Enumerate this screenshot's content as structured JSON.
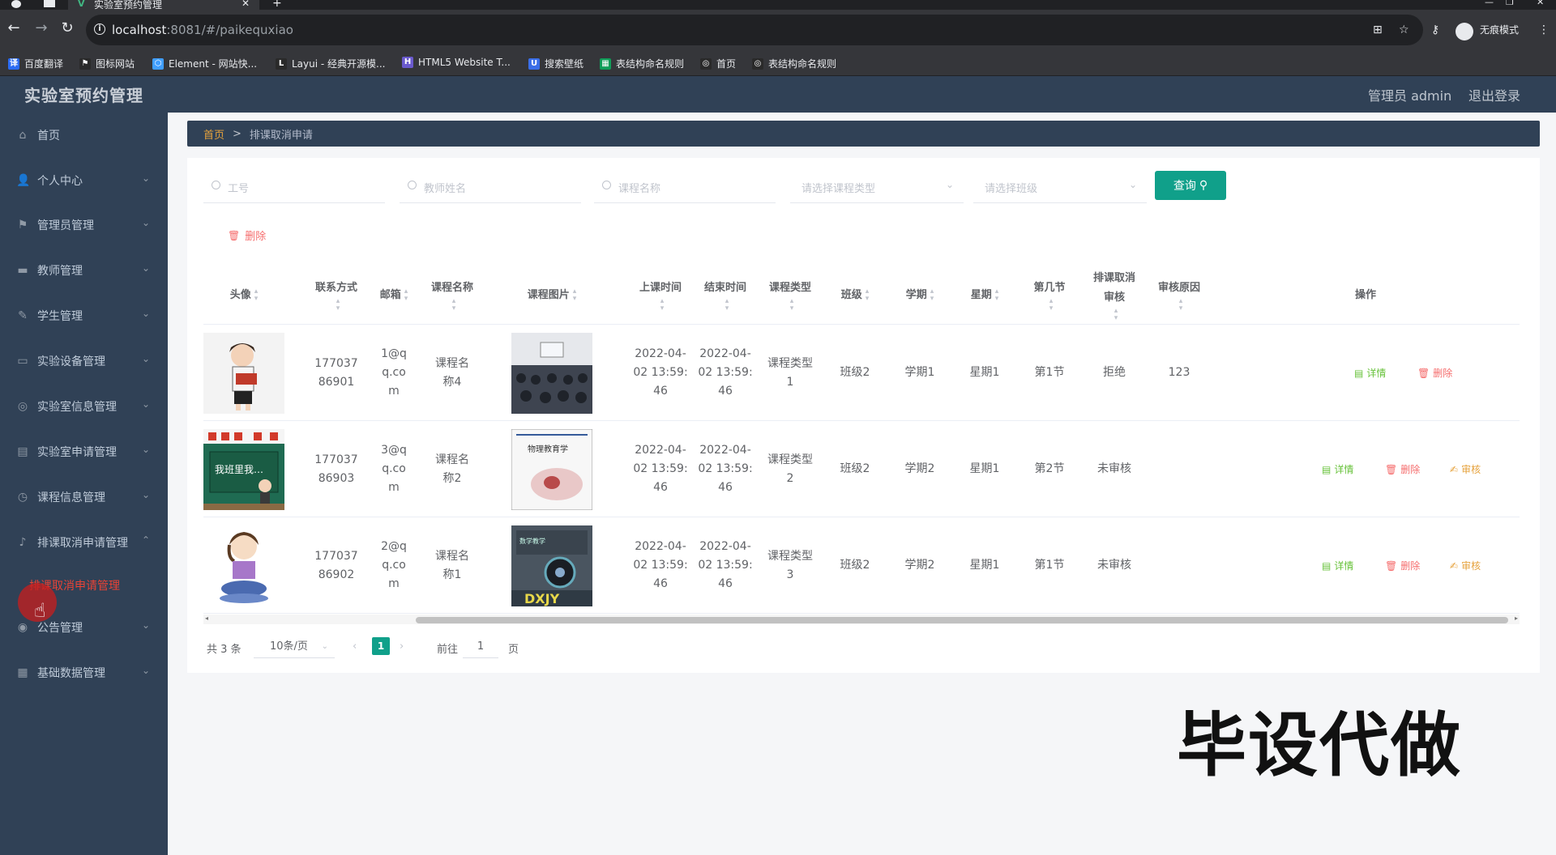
{
  "browser": {
    "tab_title": "实验室预约管理",
    "url_host": "localhost",
    "url_rest": ":8081/#/paikequxiao",
    "incognito_label": "无痕模式",
    "bookmarks": [
      {
        "label": "百度翻译",
        "color": "#2b6cf5",
        "icon": "译"
      },
      {
        "label": "图标网站",
        "color": "#2a2a2a",
        "icon": "⚑"
      },
      {
        "label": "Element - 网站快...",
        "color": "#409eff",
        "icon": "⬡"
      },
      {
        "label": "Layui - 经典开源模...",
        "color": "#2a2a2a",
        "icon": "L"
      },
      {
        "label": "HTML5 Website T...",
        "color": "#6a5acd",
        "icon": "H"
      },
      {
        "label": "搜索壁纸",
        "color": "#3a6ee8",
        "icon": "U"
      },
      {
        "label": "表结构命名规则",
        "color": "#0f9d58",
        "icon": "▦"
      },
      {
        "label": "首页",
        "color": "#2a2a2a",
        "icon": "◎"
      },
      {
        "label": "表结构命名规则",
        "color": "#2a2a2a",
        "icon": "◎"
      }
    ]
  },
  "header": {
    "title": "实验室预约管理",
    "user": "管理员 admin",
    "logout": "退出登录"
  },
  "sidebar": {
    "items": [
      {
        "label": "首页",
        "icon": "home-icon",
        "glyph": "⌂",
        "has_arrow": false
      },
      {
        "label": "个人中心",
        "icon": "user-icon",
        "glyph": "👤",
        "has_arrow": true
      },
      {
        "label": "管理员管理",
        "icon": "flag-icon",
        "glyph": "⚑",
        "has_arrow": true
      },
      {
        "label": "教师管理",
        "icon": "briefcase-icon",
        "glyph": "▬",
        "has_arrow": true
      },
      {
        "label": "学生管理",
        "icon": "edit-icon",
        "glyph": "✎",
        "has_arrow": true
      },
      {
        "label": "实验设备管理",
        "icon": "monitor-icon",
        "glyph": "▭",
        "has_arrow": true
      },
      {
        "label": "实验室信息管理",
        "icon": "target-icon",
        "glyph": "◎",
        "has_arrow": true
      },
      {
        "label": "实验室申请管理",
        "icon": "document-icon",
        "glyph": "▤",
        "has_arrow": true
      },
      {
        "label": "课程信息管理",
        "icon": "clock-icon",
        "glyph": "◷",
        "has_arrow": true
      },
      {
        "label": "排课取消申请管理",
        "icon": "mic-icon",
        "glyph": "♪",
        "has_arrow": true
      },
      {
        "label": "公告管理",
        "icon": "bell-icon",
        "glyph": "◉",
        "has_arrow": true
      },
      {
        "label": "基础数据管理",
        "icon": "calendar-icon",
        "glyph": "▦",
        "has_arrow": true
      }
    ],
    "active_sub": "排课取消申请管理"
  },
  "breadcrumb": {
    "home": "首页",
    "sep": ">",
    "current": "排课取消申请"
  },
  "search": {
    "gonghao_placeholder": "工号",
    "teacher_placeholder": "教师姓名",
    "course_placeholder": "课程名称",
    "type_placeholder": "请选择课程类型",
    "class_placeholder": "请选择班级",
    "query_label": "查询"
  },
  "actions": {
    "delete_label": "删除"
  },
  "table": {
    "headers": {
      "avatar": "头像",
      "contact": "联系方式",
      "email": "邮箱",
      "course_name": "课程名称",
      "course_img": "课程图片",
      "start": "上课时间",
      "end": "结束时间",
      "type": "课程类型",
      "class": "班级",
      "term": "学期",
      "weekday": "星期",
      "period": "第几节",
      "audit": "排课取消审核",
      "reason": "审核原因",
      "ops": "操作"
    },
    "rows": [
      {
        "contact": "17703786901",
        "email": "1@qq.com",
        "course_name": "课程名称4",
        "start": "2022-04-02 13:59:46",
        "end": "2022-04-02 13:59:46",
        "type": "课程类型1",
        "class": "班级2",
        "term": "学期1",
        "weekday": "星期1",
        "period": "第1节",
        "audit": "拒绝",
        "reason": "123",
        "ops": [
          "详情",
          "删除"
        ]
      },
      {
        "contact": "17703786903",
        "email": "3@qq.com",
        "course_name": "课程名称2",
        "start": "2022-04-02 13:59:46",
        "end": "2022-04-02 13:59:46",
        "type": "课程类型2",
        "class": "班级2",
        "term": "学期2",
        "weekday": "星期1",
        "period": "第2节",
        "audit": "未审核",
        "reason": "",
        "ops": [
          "详情",
          "删除",
          "审核"
        ]
      },
      {
        "contact": "17703786902",
        "email": "2@qq.com",
        "course_name": "课程名称1",
        "start": "2022-04-02 13:59:46",
        "end": "2022-04-02 13:59:46",
        "type": "课程类型3",
        "class": "班级2",
        "term": "学期2",
        "weekday": "星期1",
        "period": "第1节",
        "audit": "未审核",
        "reason": "",
        "ops": [
          "详情",
          "删除",
          "审核"
        ]
      }
    ]
  },
  "pagination": {
    "total": "共 3 条",
    "page_size": "10条/页",
    "current": "1",
    "goto": "前往",
    "goto_value": "1",
    "unit": "页"
  },
  "watermark": "毕设代做"
}
